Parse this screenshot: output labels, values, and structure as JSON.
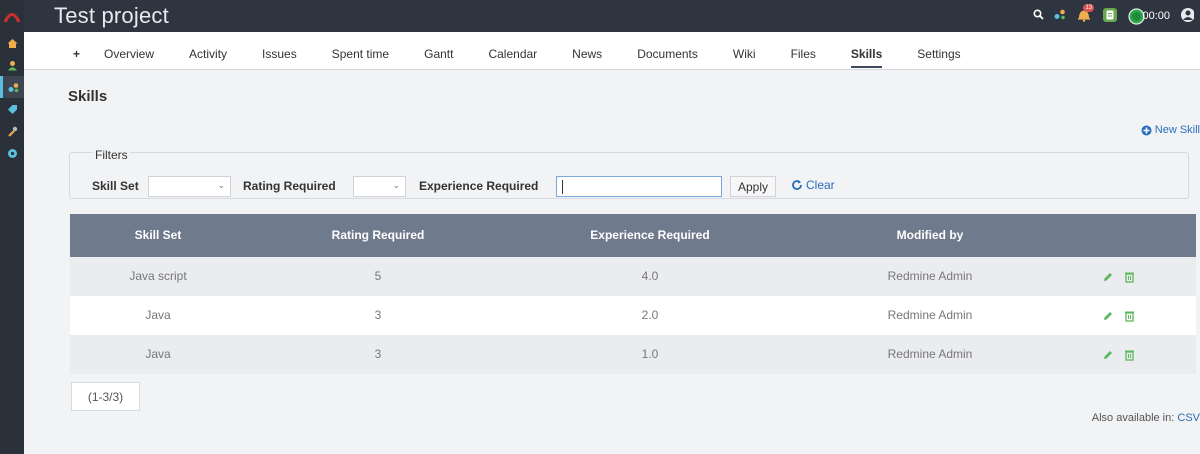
{
  "header": {
    "project_title": "Test project",
    "timer": "00:00",
    "notification_count": "13"
  },
  "menu": {
    "plus": "+",
    "tabs": [
      "Overview",
      "Activity",
      "Issues",
      "Spent time",
      "Gantt",
      "Calendar",
      "News",
      "Documents",
      "Wiki",
      "Files",
      "Skills",
      "Settings"
    ],
    "selected": "Skills"
  },
  "page": {
    "title": "Skills",
    "new_skill": "New Skill",
    "filters": {
      "legend": "Filters",
      "skill_set_label": "Skill Set",
      "skill_set_value": "",
      "rating_required_label": "Rating Required",
      "rating_required_value": "",
      "experience_required_label": "Experience Required",
      "experience_required_value": "",
      "apply": "Apply",
      "clear": "Clear"
    },
    "table": {
      "columns": [
        "Skill Set",
        "Rating Required",
        "Experience Required",
        "Modified by"
      ],
      "rows": [
        [
          "Java script",
          "5",
          "4.0",
          "Redmine Admin"
        ],
        [
          "Java",
          "3",
          "2.0",
          "Redmine Admin"
        ],
        [
          "Java",
          "3",
          "1.0",
          "Redmine Admin"
        ]
      ]
    },
    "pagination": "(1-3/3)",
    "also_available_label": "Also available in:",
    "csv": "CSV"
  },
  "colors": {
    "accent": "#2a6ebb",
    "header_bg": "#2e3440",
    "table_header": "#6f7a8c",
    "action_green": "#5cb85c"
  }
}
